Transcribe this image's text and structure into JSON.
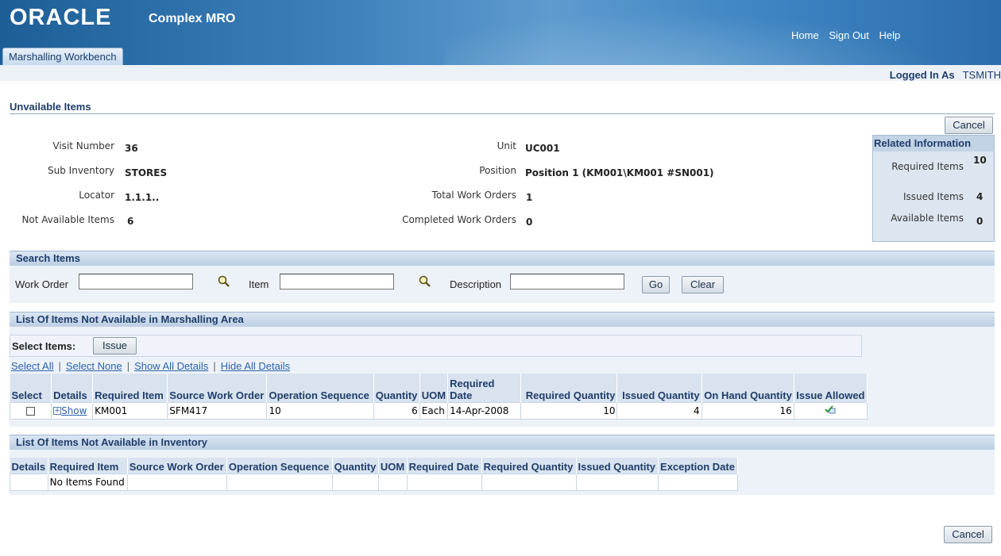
{
  "header": {
    "logo": "ORACLE",
    "app_name": "Complex MRO",
    "links": [
      "Home",
      "Sign Out",
      "Help"
    ],
    "tab": "Marshalling Workbench"
  },
  "user": {
    "label": "Logged In As",
    "name": "TSMITH"
  },
  "page": {
    "title": "Unvailable Items",
    "cancel": "Cancel"
  },
  "summary": {
    "visit_number": {
      "label": "Visit Number",
      "value": "36"
    },
    "sub_inventory": {
      "label": "Sub Inventory",
      "value": "STORES"
    },
    "locator": {
      "label": "Locator",
      "value": "1.1.1.."
    },
    "not_available": {
      "label": "Not Available Items",
      "value": "6"
    },
    "unit": {
      "label": "Unit",
      "value": "UC001"
    },
    "position": {
      "label": "Position",
      "value": "Position 1 (KM001\\KM001 #SN001)"
    },
    "total_wo": {
      "label": "Total Work Orders",
      "value": "1"
    },
    "completed_wo": {
      "label": "Completed Work Orders",
      "value": "0"
    }
  },
  "related": {
    "title": "Related Information",
    "required": {
      "label": "Required Items",
      "value": "10"
    },
    "issued": {
      "label": "Issued Items",
      "value": "4"
    },
    "available": {
      "label": "Available Items",
      "value": "0"
    }
  },
  "search": {
    "title": "Search Items",
    "work_order_label": "Work Order",
    "item_label": "Item",
    "description_label": "Description",
    "go": "Go",
    "clear": "Clear"
  },
  "marshalling": {
    "title": "List Of Items Not Available in Marshalling Area",
    "select_items": "Select Items:",
    "issue": "Issue",
    "links": [
      "Select All",
      "Select None",
      "Show All Details",
      "Hide All Details"
    ],
    "columns": [
      "Select",
      "Details",
      "Required Item",
      "Source Work Order",
      "Operation Sequence",
      "Quantity",
      "UOM",
      "Required Date",
      "Required Quantity",
      "Issued Quantity",
      "On Hand Quantity",
      "Issue Allowed"
    ],
    "rows": [
      {
        "details": "Show",
        "item": "KM001",
        "source_wo": "SFM417",
        "op_seq": "10",
        "quantity": "6",
        "uom": "Each",
        "required_date": "14-Apr-2008",
        "required_qty": "10",
        "issued_qty": "4",
        "on_hand_qty": "16",
        "issue_allowed": "check-icon"
      }
    ]
  },
  "inventory": {
    "title": "List Of Items Not Available in Inventory",
    "columns": [
      "Details",
      "Required Item",
      "Source Work Order",
      "Operation Sequence",
      "Quantity",
      "UOM",
      "Required Date",
      "Required Quantity",
      "Issued Quantity",
      "Exception Date"
    ],
    "empty": "No Items Found"
  },
  "footer": {
    "cancel": "Cancel"
  }
}
